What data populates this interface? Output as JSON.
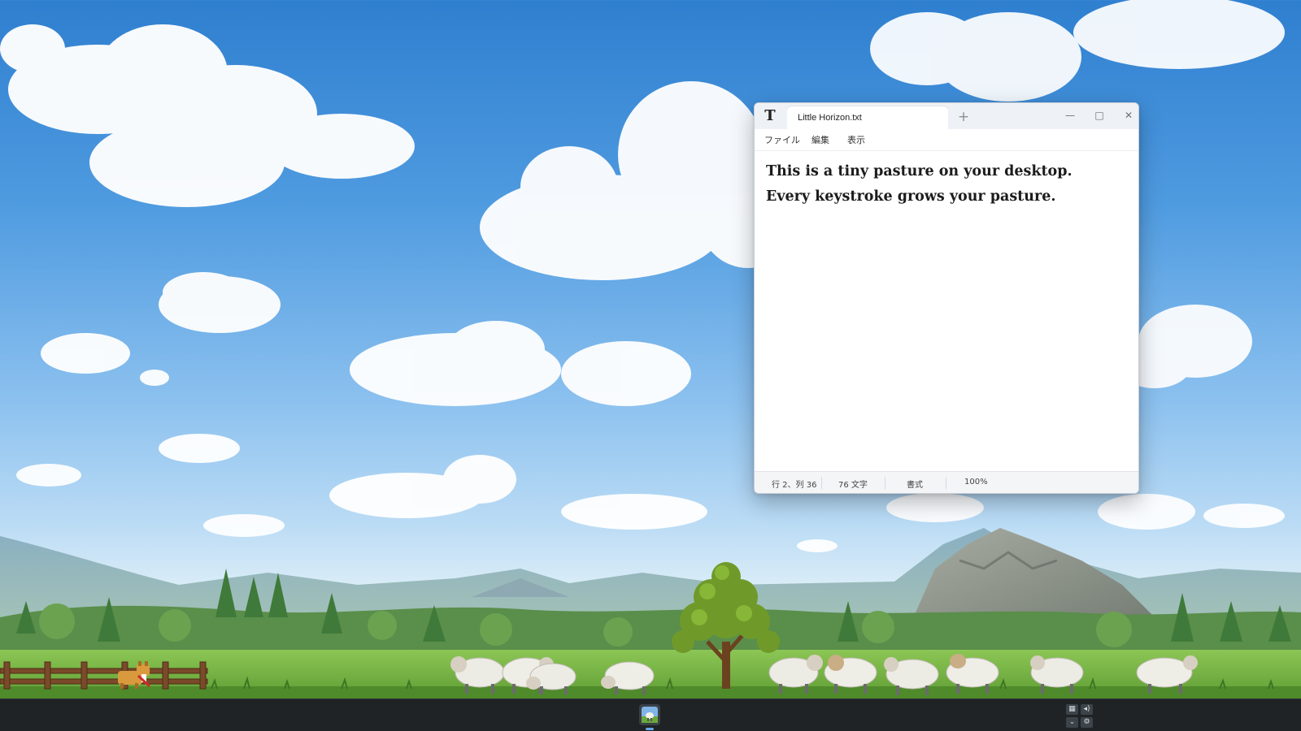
{
  "notepad": {
    "tab_title": "Little Horizon.txt",
    "new_tab_label": "+",
    "controls": {
      "minimize": "—",
      "maximize": "□",
      "close": "✕"
    },
    "menu": [
      {
        "label": "ファイル"
      },
      {
        "label": "編集"
      },
      {
        "label": "表示"
      }
    ],
    "content_lines": [
      "This is a tiny pasture on your desktop.",
      "Every keystroke grows your pasture."
    ],
    "status": {
      "position": "行 2、列 36",
      "char_count": "76 文字",
      "format": "書式",
      "zoom": "100%"
    }
  },
  "taskbar": {
    "tray_icons": [
      "network-icon",
      "volume-icon",
      "chevron-icon",
      "settings-icon"
    ]
  },
  "colors": {
    "sky_top": "#2f7fd0",
    "grass": "#6fae3d",
    "taskbar": "#1f2326",
    "accent": "#63a6e6"
  }
}
